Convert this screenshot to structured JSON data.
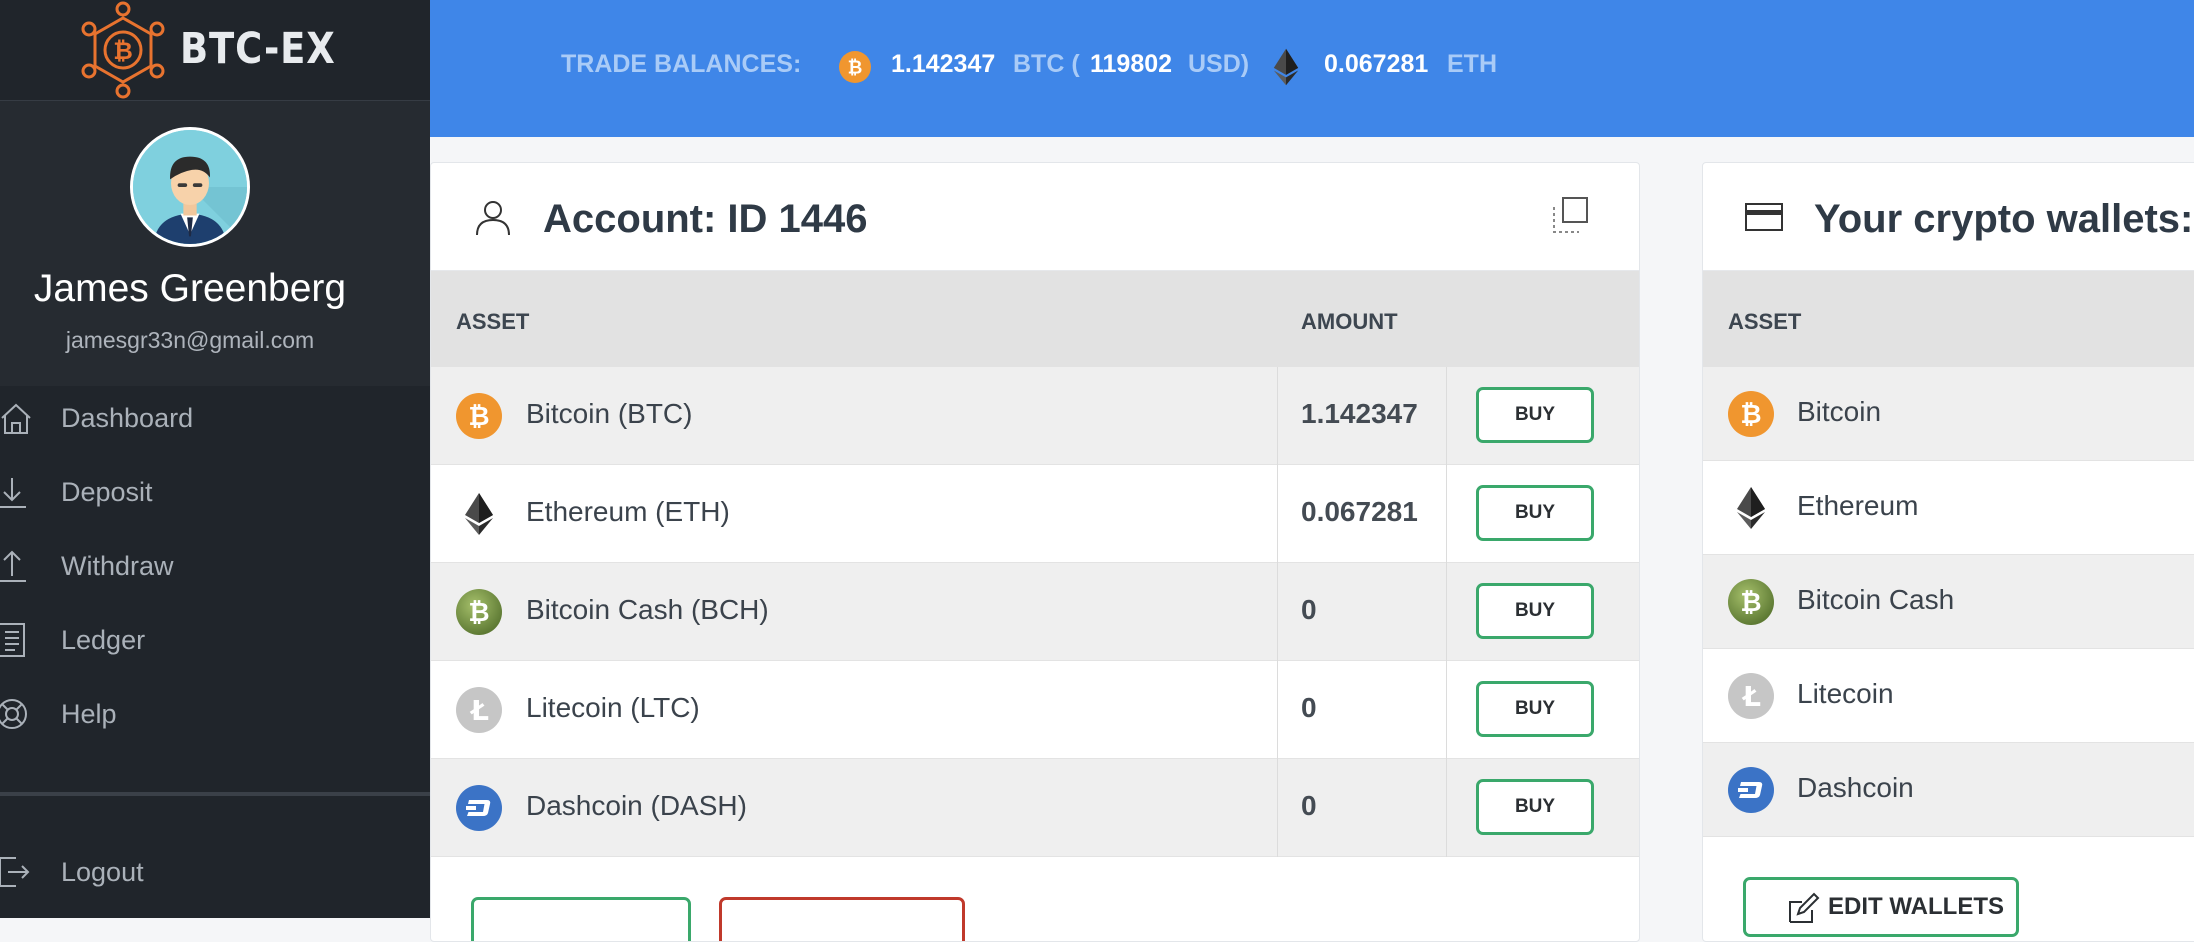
{
  "brand": {
    "name": "BTC-EX"
  },
  "user": {
    "name": "James Greenberg",
    "email": "jamesgr33n@gmail.com"
  },
  "nav": {
    "items": [
      {
        "label": "Dashboard",
        "icon": "home-icon"
      },
      {
        "label": "Deposit",
        "icon": "download-icon"
      },
      {
        "label": "Withdraw",
        "icon": "upload-icon"
      },
      {
        "label": "Ledger",
        "icon": "document-icon"
      },
      {
        "label": "Help",
        "icon": "lifebuoy-icon"
      }
    ],
    "logout": "Logout"
  },
  "balances": {
    "label": "TRADE BALANCES:",
    "btc_amount": "1.142347",
    "btc_unit": "BTC (",
    "usd_amount": "119802",
    "usd_unit": "USD)",
    "eth_amount": "0.067281",
    "eth_unit": "ETH"
  },
  "account": {
    "title": "Account: ID 1446",
    "col_asset": "ASSET",
    "col_amount": "AMOUNT",
    "buy_label": "BUY",
    "rows": [
      {
        "asset": "Bitcoin (BTC)",
        "amount": "1.142347",
        "icon": "bitcoin-icon"
      },
      {
        "asset": "Ethereum (ETH)",
        "amount": "0.067281",
        "icon": "ethereum-icon"
      },
      {
        "asset": "Bitcoin Cash (BCH)",
        "amount": "0",
        "icon": "bitcoin-cash-icon"
      },
      {
        "asset": "Litecoin (LTC)",
        "amount": "0",
        "icon": "litecoin-icon"
      },
      {
        "asset": "Dashcoin (DASH)",
        "amount": "0",
        "icon": "dash-icon"
      }
    ]
  },
  "wallets": {
    "title": "Your crypto wallets:",
    "col_asset": "ASSET",
    "edit_label": "EDIT WALLETS",
    "rows": [
      {
        "asset": "Bitcoin"
      },
      {
        "asset": "Ethereum"
      },
      {
        "asset": "Bitcoin Cash"
      },
      {
        "asset": "Litecoin"
      },
      {
        "asset": "Dashcoin"
      }
    ]
  },
  "colors": {
    "topbar": "#3f86e8",
    "sidebar": "#20252b",
    "buy_border": "#3aa86b",
    "withdraw_border": "#c0392b",
    "bitcoin": "#f0962f",
    "bitcoin_cash": "#7d9a4c",
    "litecoin": "#c6c6c6",
    "dash": "#3b73c6"
  }
}
